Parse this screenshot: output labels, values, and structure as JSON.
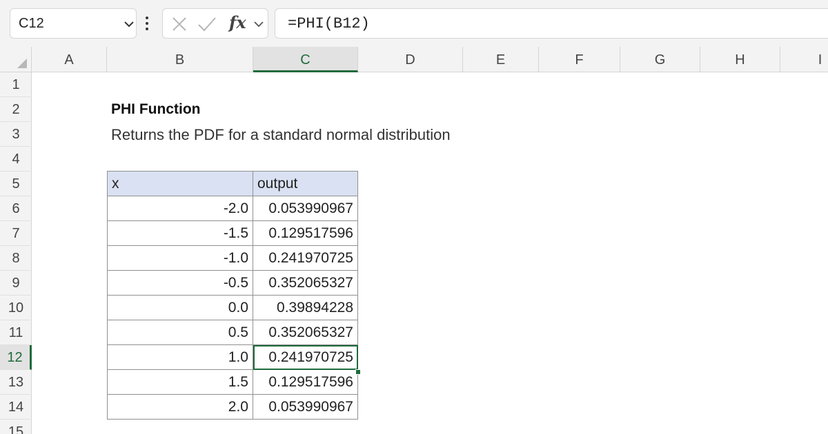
{
  "formula_bar": {
    "name_box": "C12",
    "formula": "=PHI(B12)",
    "fx_label": "fx"
  },
  "columns": [
    "A",
    "B",
    "C",
    "D",
    "E",
    "F",
    "G",
    "H",
    "I"
  ],
  "rows": [
    "1",
    "2",
    "3",
    "4",
    "5",
    "6",
    "7",
    "8",
    "9",
    "10",
    "11",
    "12",
    "13",
    "14",
    "15"
  ],
  "active_cell": {
    "column": "C",
    "row": "12"
  },
  "sheet": {
    "title": "PHI Function",
    "subtitle": "Returns the PDF for a standard normal distribution",
    "table": {
      "headers": [
        "x",
        "output"
      ],
      "rows": [
        [
          "-2.0",
          "0.053990967"
        ],
        [
          "-1.5",
          "0.129517596"
        ],
        [
          "-1.0",
          "0.241970725"
        ],
        [
          "-0.5",
          "0.352065327"
        ],
        [
          "0.0",
          "0.39894228"
        ],
        [
          "0.5",
          "0.352065327"
        ],
        [
          "1.0",
          "0.241970725"
        ],
        [
          "1.5",
          "0.129517596"
        ],
        [
          "2.0",
          "0.053990967"
        ]
      ]
    }
  },
  "colors": {
    "accent": "#1e6b3c",
    "table_header_fill": "#d9e1f2",
    "chrome_background": "#f3f3f3"
  }
}
